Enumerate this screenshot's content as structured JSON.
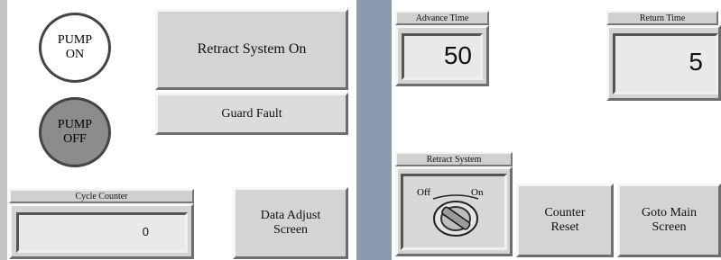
{
  "left": {
    "pump_on_label": "PUMP\nON",
    "pump_off_label": "PUMP\nOFF",
    "retract_system_on_label": "Retract System On",
    "guard_fault_label": "Guard Fault",
    "cycle_counter": {
      "title": "Cycle Counter",
      "value": "0"
    },
    "data_adjust_label": "Data Adjust\nScreen"
  },
  "right": {
    "advance_time": {
      "title": "Advance Time",
      "value": "50"
    },
    "return_time": {
      "title": "Return Time",
      "value": "5"
    },
    "retract_system": {
      "title": "Retract System",
      "off_label": "Off",
      "on_label": "On"
    },
    "counter_reset_label": "Counter\nReset",
    "goto_main_label": "Goto Main\nScreen"
  },
  "colors": {
    "background": "#8a9bb0",
    "panel": "#ffffff",
    "button_face": "#d4d4d4",
    "pump_on_fill": "#ffffff",
    "pump_off_fill": "#8c8c8c"
  }
}
